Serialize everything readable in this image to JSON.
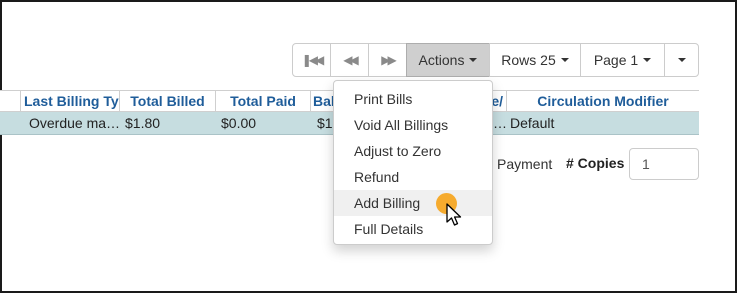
{
  "toolbar": {
    "first_icon": "first-page-icon",
    "prev_icon": "previous-page-icon",
    "next_icon": "next-page-icon",
    "actions_label": "Actions",
    "rows_label": "Rows 25",
    "page_label": "Page 1",
    "more_icon": "chevron-down-icon"
  },
  "grid": {
    "headers": [
      "Last Billing Ty",
      "Total Billed",
      "Total Paid",
      "Bal",
      "te/",
      "Circulation Modifier"
    ],
    "row": {
      "last_billing_type": "Overdue ma…",
      "total_billed": "$1.80",
      "total_paid": "$0.00",
      "balance": "$1",
      "date_trunc": "…",
      "circulation_modifier": "Default"
    }
  },
  "actions_menu": {
    "items": [
      "Print Bills",
      "Void All Billings",
      "Adjust to Zero",
      "Refund",
      "Add Billing",
      "Full Details"
    ],
    "hovered_index": 4
  },
  "payment": {
    "payment_text": "Payment",
    "copies_label": "# Copies",
    "copies_value": "1"
  },
  "colors": {
    "header_text": "#1f5d9a",
    "selected_row": "#c6dde0",
    "active_button": "#cfcfcf",
    "cursor_highlight": "#f5a623"
  }
}
